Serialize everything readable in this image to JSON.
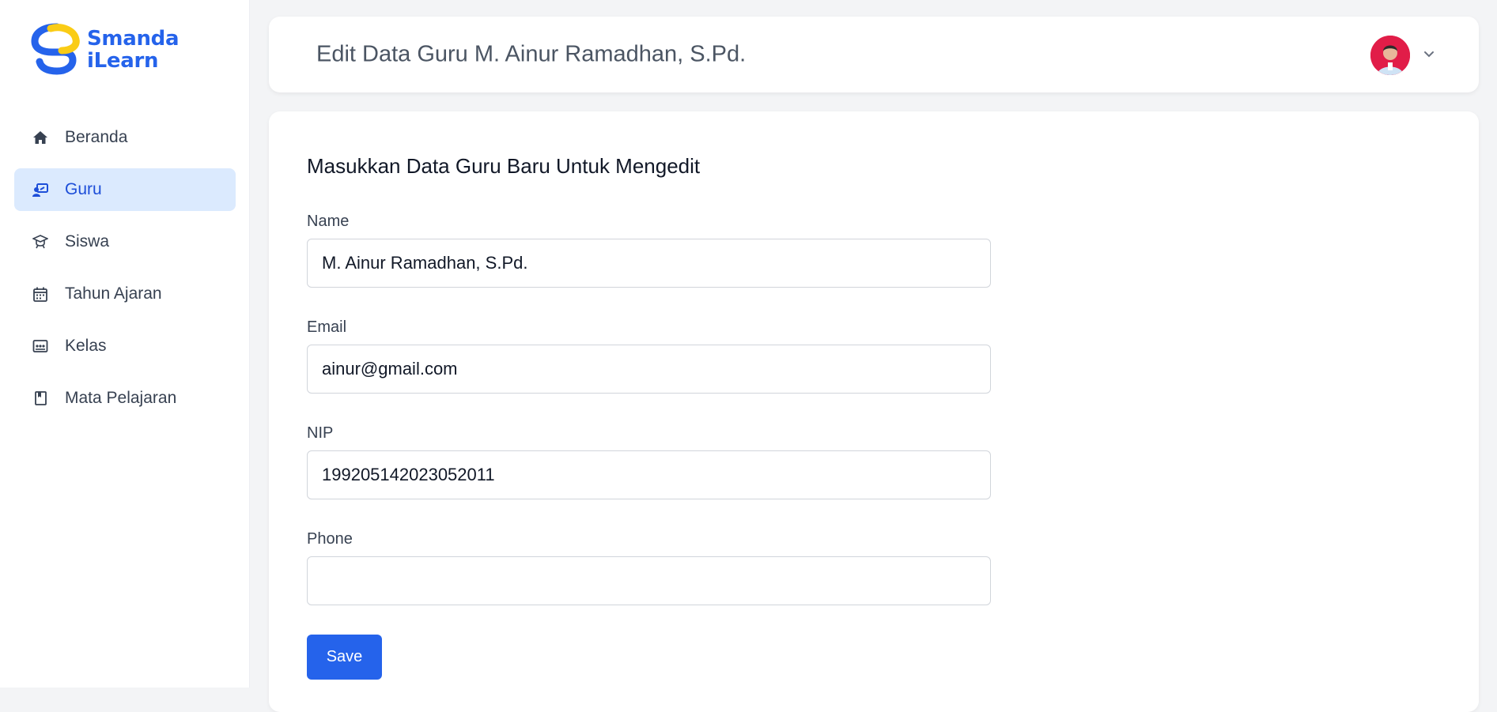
{
  "app": {
    "logo_line1": "Smanda",
    "logo_line2": "iLearn",
    "brand_color": "#2563eb",
    "accent_color": "#facc15"
  },
  "sidebar": {
    "items": [
      {
        "label": "Beranda",
        "icon": "home-icon",
        "active": false
      },
      {
        "label": "Guru",
        "icon": "teacher-icon",
        "active": true
      },
      {
        "label": "Siswa",
        "icon": "student-icon",
        "active": false
      },
      {
        "label": "Tahun Ajaran",
        "icon": "calendar-icon",
        "active": false
      },
      {
        "label": "Kelas",
        "icon": "classroom-icon",
        "active": false
      },
      {
        "label": "Mata Pelajaran",
        "icon": "book-icon",
        "active": false
      }
    ]
  },
  "header": {
    "title": "Edit Data Guru M. Ainur Ramadhan, S.Pd.",
    "avatar_icon": "user-avatar",
    "menu_icon": "chevron-down-icon"
  },
  "form": {
    "heading": "Masukkan Data Guru Baru Untuk Mengedit",
    "fields": {
      "name": {
        "label": "Name",
        "value": "M. Ainur Ramadhan, S.Pd."
      },
      "email": {
        "label": "Email",
        "value": "ainur@gmail.com"
      },
      "nip": {
        "label": "NIP",
        "value": "199205142023052011"
      },
      "phone": {
        "label": "Phone",
        "value": ""
      }
    },
    "save_label": "Save"
  }
}
